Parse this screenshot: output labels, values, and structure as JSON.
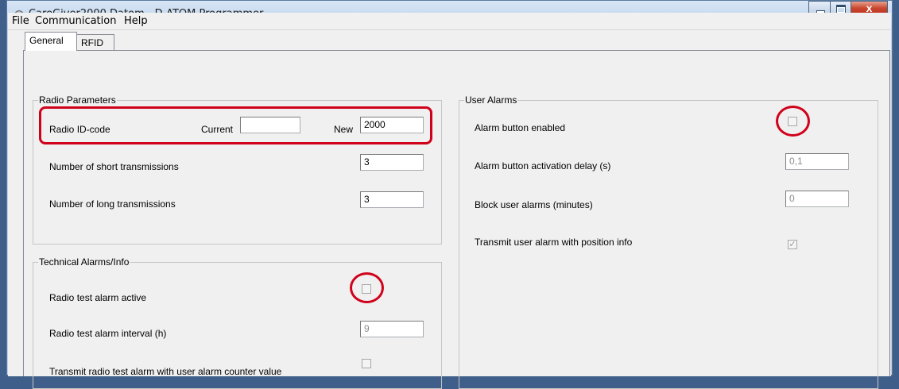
{
  "window": {
    "title": "CareGiver2000.Datom - D-ATOM Programmer",
    "close_glyph": "x"
  },
  "menu": [
    "File",
    "Communication",
    "Help"
  ],
  "tabs": [
    "General",
    "RFID"
  ],
  "radio_parameters": {
    "title": "Radio Parameters",
    "radio_id_label": "Radio ID-code",
    "current_label": "Current",
    "current_value": "",
    "new_label": "New",
    "new_value": "2000",
    "short_tx_label": "Number of short transmissions",
    "short_tx_value": "3",
    "long_tx_label": "Number of long transmissions",
    "long_tx_value": "3"
  },
  "technical_alarms": {
    "title": "Technical Alarms/Info",
    "radio_test_label": "Radio test alarm active",
    "radio_test_checked": false,
    "interval_label": "Radio test alarm interval (h)",
    "interval_value": "9",
    "counter_label": "Transmit radio test alarm with user alarm counter value",
    "counter_checked": false
  },
  "user_alarms": {
    "title": "User Alarms",
    "alarm_button_label": "Alarm button enabled",
    "alarm_button_checked": false,
    "delay_label": "Alarm button activation delay (s)",
    "delay_value": "0,1",
    "block_label": "Block user alarms (minutes)",
    "block_value": "0",
    "position_label": "Transmit user alarm with position info",
    "position_checked": true,
    "check_glyph": "✓"
  },
  "colors": {
    "highlight": "#d0021b",
    "title_bar": "#bcd3ea",
    "close_button": "#c9452d"
  }
}
